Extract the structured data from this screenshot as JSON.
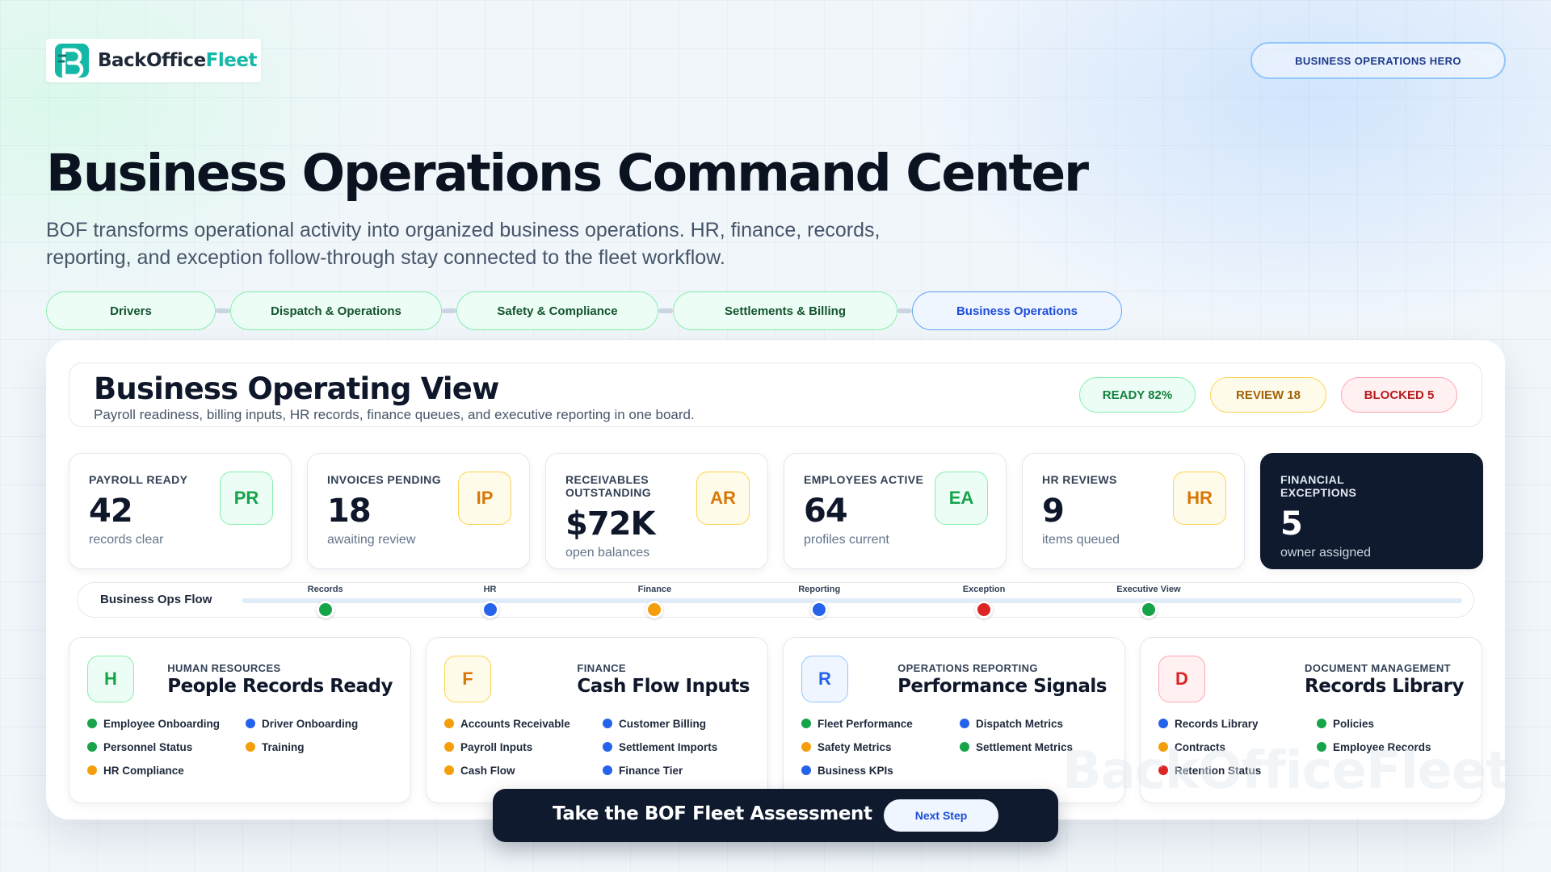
{
  "header": {
    "logo_text_1": "BackOffice",
    "logo_text_2": "Fleet",
    "hero_badge": "BUSINESS OPERATIONS HERO",
    "title": "Business Operations Command Center",
    "subtitle": "BOF transforms operational activity into organized business operations. HR, finance, records, reporting, and exception follow-through stay connected to the fleet workflow."
  },
  "nav": [
    {
      "label": "Drivers"
    },
    {
      "label": "Dispatch & Operations"
    },
    {
      "label": "Safety & Compliance"
    },
    {
      "label": "Settlements & Billing"
    },
    {
      "label": "Business Operations",
      "active": true
    }
  ],
  "board": {
    "title": "Business Operating View",
    "subtitle": "Payroll readiness, billing inputs, HR records, finance queues, and executive reporting in one board.",
    "status": {
      "ready": "READY 82%",
      "review": "REVIEW 18",
      "blocked": "BLOCKED 5"
    }
  },
  "kpis": [
    {
      "label": "PAYROLL READY",
      "value": "42",
      "note": "records clear",
      "badge": "PR",
      "tone": "green"
    },
    {
      "label": "INVOICES PENDING",
      "value": "18",
      "note": "awaiting review",
      "badge": "IP",
      "tone": "amber"
    },
    {
      "label": "RECEIVABLES OUTSTANDING",
      "value": "$72K",
      "note": "open balances",
      "badge": "AR",
      "tone": "amber"
    },
    {
      "label": "EMPLOYEES ACTIVE",
      "value": "64",
      "note": "profiles current",
      "badge": "EA",
      "tone": "green"
    },
    {
      "label": "HR REVIEWS",
      "value": "9",
      "note": "items queued",
      "badge": "HR",
      "tone": "amber"
    },
    {
      "label": "FINANCIAL EXCEPTIONS",
      "value": "5",
      "note": "owner assigned",
      "tone": "dark"
    }
  ],
  "flow": {
    "label": "Business Ops Flow",
    "steps": [
      {
        "label": "Records",
        "color": "#16a34a"
      },
      {
        "label": "HR",
        "color": "#2563eb"
      },
      {
        "label": "Finance",
        "color": "#f59e0b"
      },
      {
        "label": "Reporting",
        "color": "#2563eb"
      },
      {
        "label": "Exception",
        "color": "#dc2626"
      },
      {
        "label": "Executive View",
        "color": "#16a34a"
      }
    ]
  },
  "modules": [
    {
      "icon": "H",
      "kicker": "HUMAN RESOURCES",
      "title": "People Records Ready",
      "items": [
        {
          "label": "Employee Onboarding",
          "color": "#16a34a"
        },
        {
          "label": "Driver Onboarding",
          "color": "#2563eb"
        },
        {
          "label": "Personnel Status",
          "color": "#16a34a"
        },
        {
          "label": "Training",
          "color": "#f59e0b"
        },
        {
          "label": "HR Compliance",
          "color": "#f59e0b"
        }
      ]
    },
    {
      "icon": "F",
      "kicker": "FINANCE",
      "title": "Cash Flow Inputs",
      "items": [
        {
          "label": "Accounts Receivable",
          "color": "#f59e0b"
        },
        {
          "label": "Customer Billing",
          "color": "#2563eb"
        },
        {
          "label": "Payroll Inputs",
          "color": "#f59e0b"
        },
        {
          "label": "Settlement Imports",
          "color": "#2563eb"
        },
        {
          "label": "Cash Flow",
          "color": "#f59e0b"
        },
        {
          "label": "Finance Tier",
          "color": "#2563eb"
        }
      ]
    },
    {
      "icon": "R",
      "kicker": "OPERATIONS REPORTING",
      "title": "Performance Signals",
      "items": [
        {
          "label": "Fleet Performance",
          "color": "#16a34a"
        },
        {
          "label": "Dispatch Metrics",
          "color": "#2563eb"
        },
        {
          "label": "Safety Metrics",
          "color": "#f59e0b"
        },
        {
          "label": "Settlement Metrics",
          "color": "#16a34a"
        },
        {
          "label": "Business KPIs",
          "color": "#2563eb"
        }
      ]
    },
    {
      "icon": "D",
      "kicker": "DOCUMENT MANAGEMENT",
      "title": "Records Library",
      "items": [
        {
          "label": "Records Library",
          "color": "#2563eb"
        },
        {
          "label": "Policies",
          "color": "#16a34a"
        },
        {
          "label": "Contracts",
          "color": "#f59e0b"
        },
        {
          "label": "Employee Records",
          "color": "#16a34a"
        },
        {
          "label": "Retention Status",
          "color": "#dc2626"
        }
      ]
    }
  ],
  "watermark": "BackOfficeFleet",
  "cta": {
    "text": "Take the BOF Fleet Assessment",
    "button": "Next Step"
  }
}
